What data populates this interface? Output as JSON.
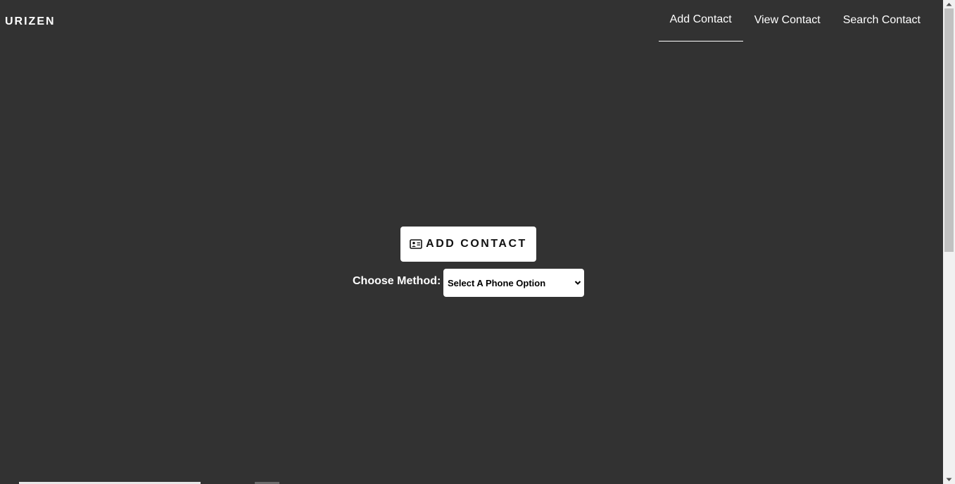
{
  "header": {
    "brand": "URIZEN",
    "nav": [
      {
        "label": "Add Contact",
        "active": true
      },
      {
        "label": "View Contact",
        "active": false
      },
      {
        "label": "Search Contact",
        "active": false
      }
    ]
  },
  "main": {
    "add_button_label": "ADD CONTACT",
    "add_button_icon": "address-card-icon",
    "method_label": "Choose Method:",
    "method_select_value": "Select A Phone Option"
  },
  "colors": {
    "background": "#323232",
    "text": "#ffffff",
    "button_bg": "#ffffff"
  }
}
